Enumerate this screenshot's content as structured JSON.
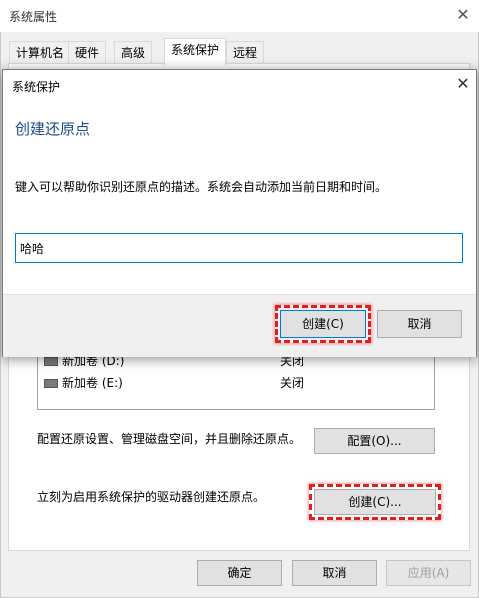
{
  "outer": {
    "title": "系统属性",
    "tabs": [
      "计算机名",
      "硬件",
      "高级",
      "系统保护",
      "远程"
    ],
    "drives": [
      {
        "name": "新加卷 (D:)",
        "protection": "关闭"
      },
      {
        "name": "新加卷 (E:)",
        "protection": "关闭"
      }
    ],
    "configure_text": "配置还原设置、管理磁盘空间，并且删除还原点。",
    "configure_button": "配置(O)...",
    "create_text": "立刻为启用系统保护的驱动器创建还原点。",
    "create_button": "创建(C)...",
    "ok_button": "确定",
    "cancel_button": "取消",
    "apply_button": "应用(A)"
  },
  "dialog": {
    "title": "系统保护",
    "heading": "创建还原点",
    "description": "键入可以帮助你识别还原点的描述。系统会自动添加当前日期和时间。",
    "input_value": "哈哈",
    "create_button": "创建(C)",
    "cancel_button": "取消"
  },
  "colors": {
    "highlight": "#e02020",
    "heading": "#1e4a8c",
    "focus": "#0078d7"
  },
  "icons": {
    "close": "close-icon",
    "drive": "drive-icon"
  }
}
